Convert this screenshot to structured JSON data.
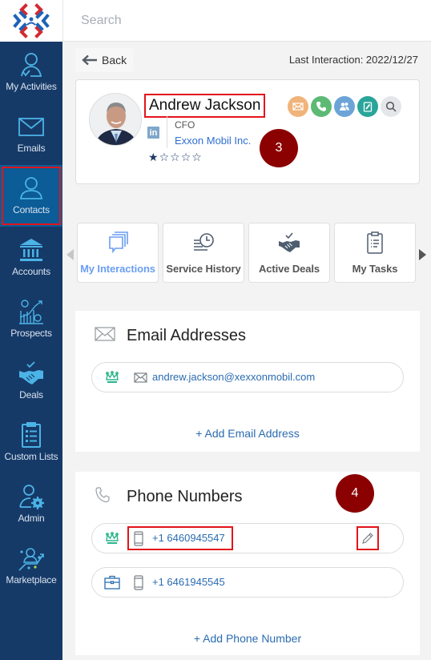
{
  "search": {
    "placeholder": "Search"
  },
  "sidebar": {
    "items": [
      {
        "label": "My Activities",
        "icon": "user-check-icon"
      },
      {
        "label": "Emails",
        "icon": "envelope-icon"
      },
      {
        "label": "Contacts",
        "icon": "person-icon",
        "active": true
      },
      {
        "label": "Accounts",
        "icon": "bank-icon"
      },
      {
        "label": "Prospects",
        "icon": "chart-gears-icon"
      },
      {
        "label": "Deals",
        "icon": "handshake-icon"
      },
      {
        "label": "Custom Lists",
        "icon": "clipboard-list-icon"
      },
      {
        "label": "Admin",
        "icon": "user-gear-icon"
      },
      {
        "label": "Marketplace",
        "icon": "marketplace-icon"
      }
    ]
  },
  "header": {
    "back_label": "Back",
    "last_interaction": "Last Interaction: 2022/12/27"
  },
  "contact": {
    "name": "Andrew Jackson",
    "title": "CFO",
    "company": "Exxon Mobil Inc.",
    "linkedin": "in",
    "rating": 1,
    "rating_max": 5,
    "star_filled": "★",
    "star_empty": "☆"
  },
  "actions": [
    {
      "name": "email",
      "color": "#f0b47a"
    },
    {
      "name": "call",
      "color": "#5cba75"
    },
    {
      "name": "meeting",
      "color": "#6ca4d8"
    },
    {
      "name": "note",
      "color": "#2aa59a"
    },
    {
      "name": "search",
      "color": "#e4e6ea"
    }
  ],
  "annotations": {
    "badge_3": "3",
    "badge_4": "4"
  },
  "tabs": [
    {
      "label": "My Interactions",
      "active": true
    },
    {
      "label": "Service History"
    },
    {
      "label": "Active Deals"
    },
    {
      "label": "My Tasks"
    }
  ],
  "emails": {
    "title": "Email Addresses",
    "items": [
      {
        "value": "andrew.jackson@xexxonmobil.com",
        "primary": true
      }
    ],
    "add_label": "+ Add Email Address"
  },
  "phones": {
    "title": "Phone Numbers",
    "items": [
      {
        "value": "+1 6460945547",
        "primary": true,
        "type": "mobile"
      },
      {
        "value": "+1 6461945545",
        "primary": false,
        "type": "work"
      }
    ],
    "add_label": "+ Add Phone Number"
  },
  "colors": {
    "sidebar_bg": "#163a68",
    "sidebar_active": "#0b5c97",
    "highlight_red": "#e3141b",
    "badge_bg": "#8b0000",
    "link_blue": "#2b6cb0",
    "crown_green": "#2bb58b"
  }
}
